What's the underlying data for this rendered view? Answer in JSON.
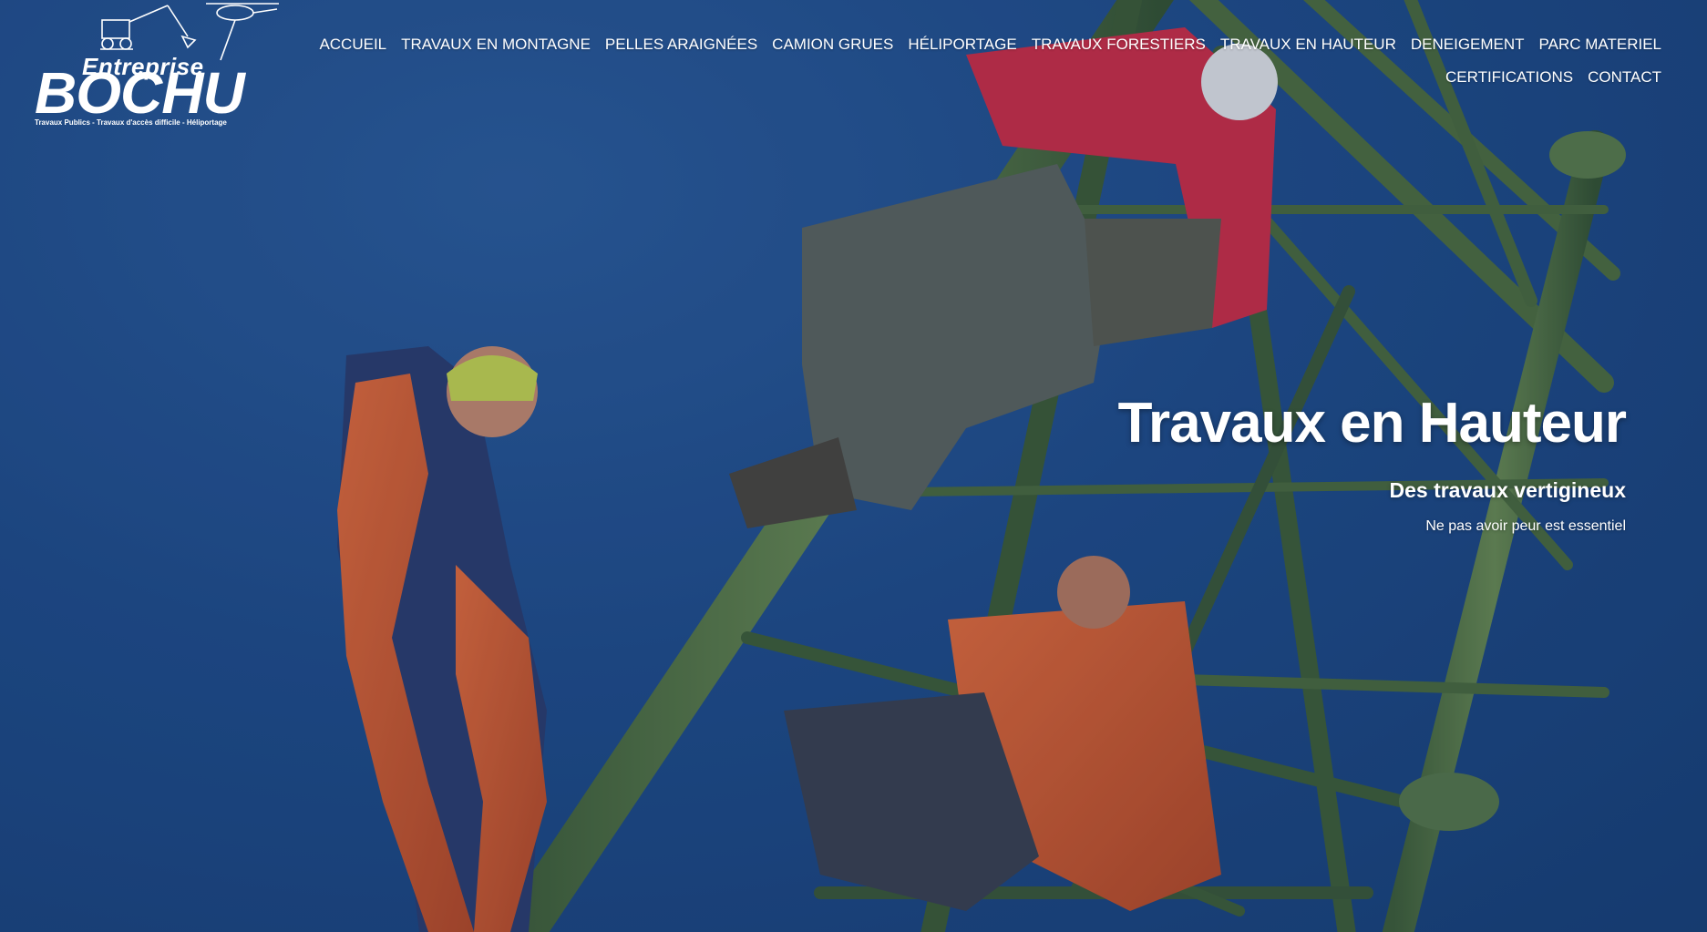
{
  "logo": {
    "brand_top": "Entreprise",
    "brand_main": "BOCHU",
    "brand_sub": "Travaux Publics - Travaux d'accès difficile - Héliportage"
  },
  "nav": {
    "items": [
      {
        "label": "ACCUEIL"
      },
      {
        "label": "TRAVAUX EN MONTAGNE"
      },
      {
        "label": "PELLES ARAIGNÉES"
      },
      {
        "label": "CAMION GRUES"
      },
      {
        "label": "HÉLIPORTAGE"
      },
      {
        "label": "TRAVAUX FORESTIERS"
      },
      {
        "label": "TRAVAUX EN HAUTEUR"
      },
      {
        "label": "DENEIGEMENT"
      },
      {
        "label": "PARC MATERIEL"
      },
      {
        "label": "CERTIFICATIONS"
      },
      {
        "label": "CONTACT"
      }
    ]
  },
  "hero": {
    "title": "Travaux en Hauteur",
    "subtitle": "Des travaux vertigineux",
    "tagline": "Ne pas avoir peur est essentiel"
  },
  "colors": {
    "sky": "#1e4a86",
    "pylon": "#4a6b3a",
    "worker_orange": "#e0652e",
    "worker_red": "#d8283e",
    "text": "#ffffff"
  }
}
